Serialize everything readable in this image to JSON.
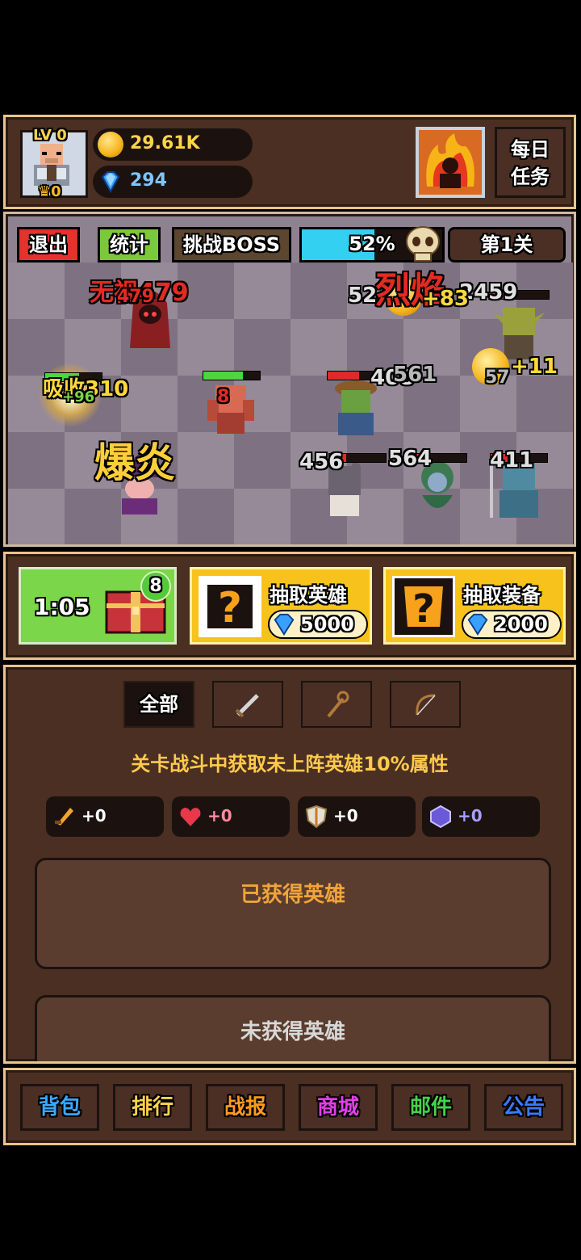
{
  "player": {
    "level": "LV 0",
    "trophies": "0",
    "gold": "29.61K",
    "gems": "294",
    "daily_line1": "每日",
    "daily_line2": "任务"
  },
  "battle": {
    "exit": "退出",
    "stats": "统计",
    "challenge_boss": "挑战BOSS",
    "progress_pct": "52%",
    "progress": 0.52,
    "stage": "第1关",
    "effects": {
      "crit_label": "无视479",
      "crit_small": "479",
      "absorb": "吸收310",
      "heal": "+96",
      "burst": "爆炎",
      "slash": "烈焰",
      "dmg_a": "52",
      "dmg_b": "2459",
      "dmg_c": "408",
      "dmg_d": "561",
      "dmg_e": "57",
      "dmg_f": "456",
      "dmg_g": "564",
      "dmg_h": "411",
      "dmg_i": "8",
      "coin_a": "+83",
      "coin_b": "+11"
    }
  },
  "draw": {
    "timer": "1:05",
    "chest_count": "8",
    "hero_label": "抽取英雄",
    "hero_price": "5000",
    "gear_label": "抽取装备",
    "gear_price": "2000"
  },
  "heroes": {
    "filters": [
      "全部",
      "",
      "",
      ""
    ],
    "desc": "关卡战斗中获取未上阵英雄10%属性",
    "stats": [
      "+0",
      "+0",
      "+0",
      "+0"
    ],
    "owned": "已获得英雄",
    "unowned": "未获得英雄"
  },
  "nav": [
    {
      "label": "背包",
      "color": "#3aa8ff"
    },
    {
      "label": "排行",
      "color": "#ffd34a"
    },
    {
      "label": "战报",
      "color": "#ff9a1f"
    },
    {
      "label": "商城",
      "color": "#e040e8"
    },
    {
      "label": "邮件",
      "color": "#45d24a"
    },
    {
      "label": "公告",
      "color": "#3a7bff"
    }
  ]
}
